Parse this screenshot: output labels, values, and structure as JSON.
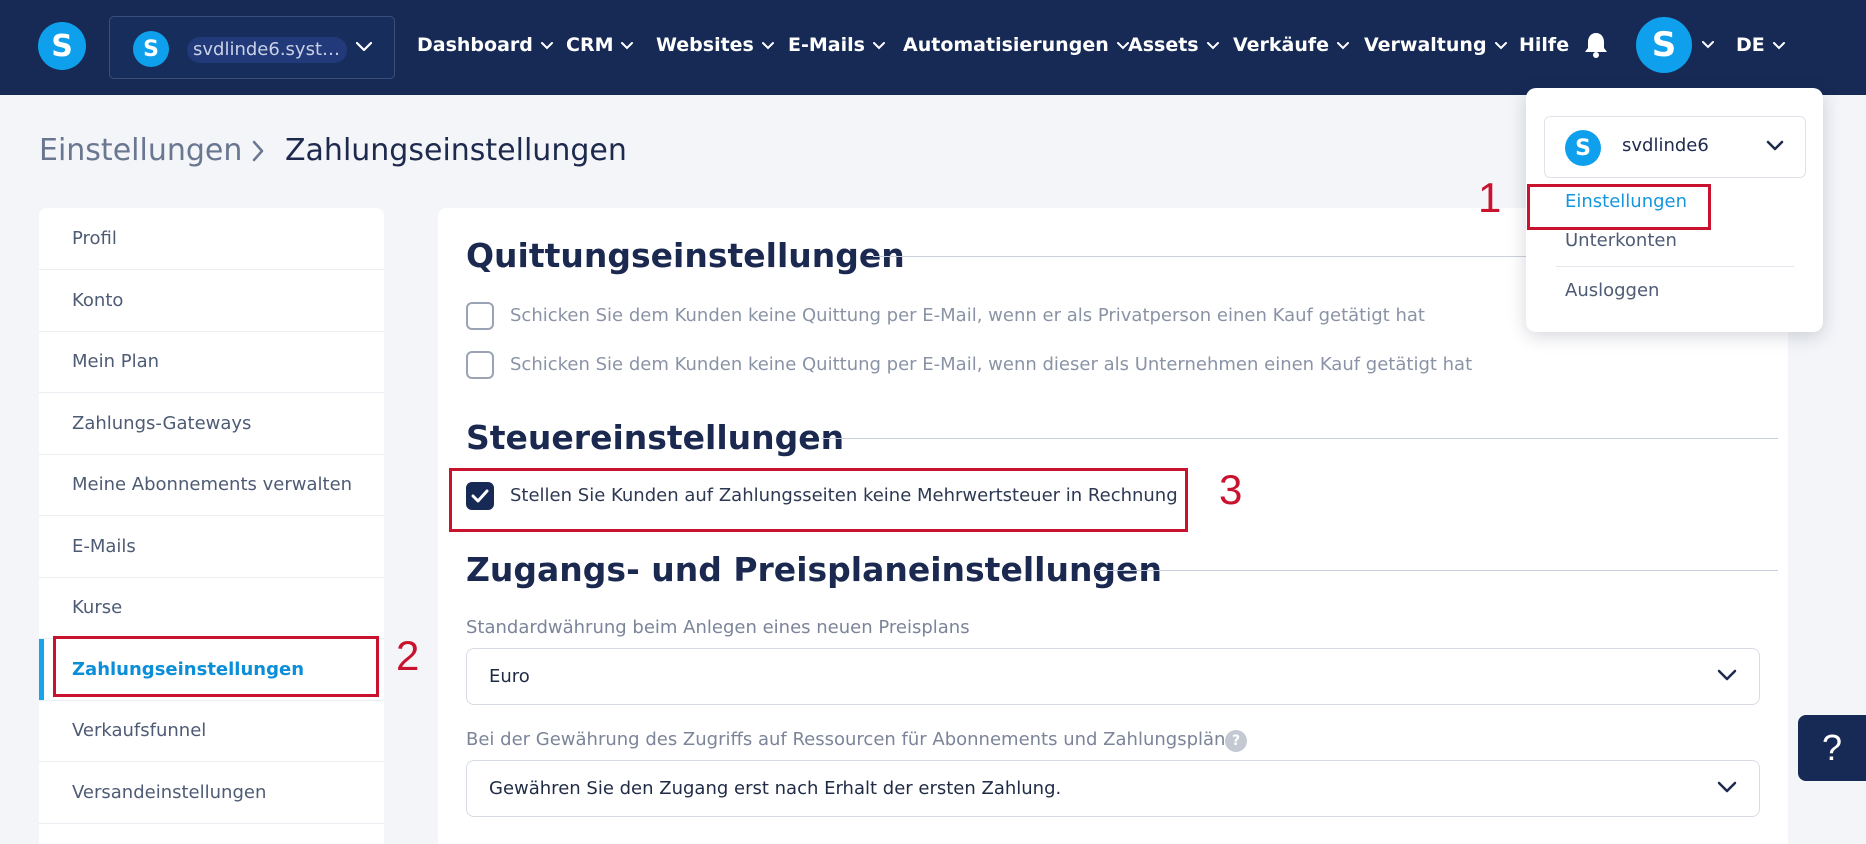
{
  "topnav": {
    "logo_letter": "S",
    "account_selector_name": "svdlinde6.syst…",
    "items": [
      {
        "label": "Dashboard"
      },
      {
        "label": "CRM"
      },
      {
        "label": "Websites"
      },
      {
        "label": "E-Mails"
      },
      {
        "label": "Automatisierungen"
      },
      {
        "label": "Assets"
      },
      {
        "label": "Verkäufe"
      },
      {
        "label": "Verwaltung"
      }
    ],
    "help_label": "Hilfe",
    "avatar_letter": "S",
    "language": "DE"
  },
  "breadcrumb": {
    "parent": "Einstellungen",
    "current": "Zahlungseinstellungen"
  },
  "sidebar": {
    "items": [
      {
        "label": "Profil"
      },
      {
        "label": "Konto"
      },
      {
        "label": "Mein Plan"
      },
      {
        "label": "Zahlungs-Gateways"
      },
      {
        "label": "Meine Abonnements verwalten"
      },
      {
        "label": "E-Mails"
      },
      {
        "label": "Kurse"
      },
      {
        "label": "Zahlungseinstellungen"
      },
      {
        "label": "Verkaufsfunnel"
      },
      {
        "label": "Versandeinstellungen"
      }
    ],
    "active_index": 7
  },
  "receipt_settings": {
    "title": "Quittungseinstellungen",
    "options": [
      {
        "label": "Schicken Sie dem Kunden keine Quittung per E-Mail, wenn er als Privatperson einen Kauf getätigt hat",
        "checked": false
      },
      {
        "label": "Schicken Sie dem Kunden keine Quittung per E-Mail, wenn dieser als Unternehmen einen Kauf getätigt hat",
        "checked": false
      }
    ]
  },
  "tax_settings": {
    "title": "Steuereinstellungen",
    "option": {
      "label": "Stellen Sie Kunden auf Zahlungsseiten keine Mehrwertsteuer in Rechnung",
      "checked": true
    }
  },
  "access_settings": {
    "title": "Zugangs- und Preisplaneinstellungen",
    "currency_label": "Standardwährung beim Anlegen eines neuen Preisplans",
    "currency_value": "Euro",
    "access_label": "Bei der Gewährung des Zugriffs auf Ressourcen für Abonnements und Zahlungspläne",
    "access_help": "?",
    "access_value": "Gewähren Sie den Zugang erst nach Erhalt der ersten Zahlung."
  },
  "user_menu": {
    "account_name": "svdlinde6",
    "account_letter": "S",
    "items": [
      {
        "label": "Einstellungen"
      },
      {
        "label": "Unterkonten"
      },
      {
        "label": "Ausloggen"
      }
    ]
  },
  "annotations": {
    "step1": "1",
    "step2": "2",
    "step3": "3"
  },
  "help_button": "?",
  "colors": {
    "nav_bg": "#162a55",
    "brand_blue": "#0ea0ec",
    "active_blue": "#0b8ed8",
    "annotation_red": "#c8122e"
  }
}
